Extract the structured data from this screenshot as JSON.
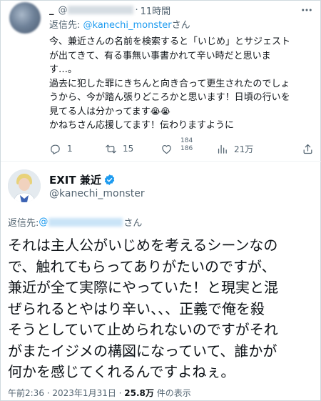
{
  "reply": {
    "name": "_",
    "handle_prefix": "@",
    "time": "11時間",
    "reply_to_label": "返信先: ",
    "reply_to_mention": "@kanechi_monster",
    "reply_to_suffix": "さん",
    "body": [
      "今、兼近さんの名前を検索すると「いじめ」とサジェスト",
      "が出てきて、有る事無い事書かれて辛い時だと思いま",
      "す…。",
      "過去に犯した罪にきちんと向き合って更生されたのでしょ",
      "うから、今が踏ん張りどころかと思います！日頃の行いを",
      "見てる人は分かってます",
      "かねちさん応援してます！伝わりますように"
    ],
    "emoji": "😭😭",
    "actions": {
      "reply_count": "1",
      "retweet_count": "15",
      "like_count": "184 186",
      "view_count": "21万"
    }
  },
  "main": {
    "display_name": "EXIT 兼近",
    "handle": "@kanechi_monster",
    "reply_to_label": "返信先: ",
    "reply_to_prefix": "@",
    "reply_to_suffix": "さん",
    "body_lines": [
      "それは主人公がいじめを考えるシーンなの",
      "で、触れてもらってありがたいのですが、",
      "兼近が全て実際にやっていた！と現実と混",
      "ぜられるとやはり辛い、、、正義で俺を殺",
      "そうとしていて止められないのですがそれ",
      "がまたイジメの構図になっていて、誰かが",
      "何かを感じてくれるんですよねぇ。"
    ],
    "timestamp": "午前2:36 · 2023年1月31日 · ",
    "view_count": "25.8万",
    "view_label": " 件の表示"
  },
  "icons": [
    "more-icon",
    "reply-icon",
    "retweet-icon",
    "like-icon",
    "views-icon",
    "share-icon",
    "verified-badge-icon"
  ],
  "colors": {
    "accent": "#1d9bf0",
    "secondary_text": "#536471",
    "primary_text": "#0f1419",
    "border": "#cfd9de"
  }
}
